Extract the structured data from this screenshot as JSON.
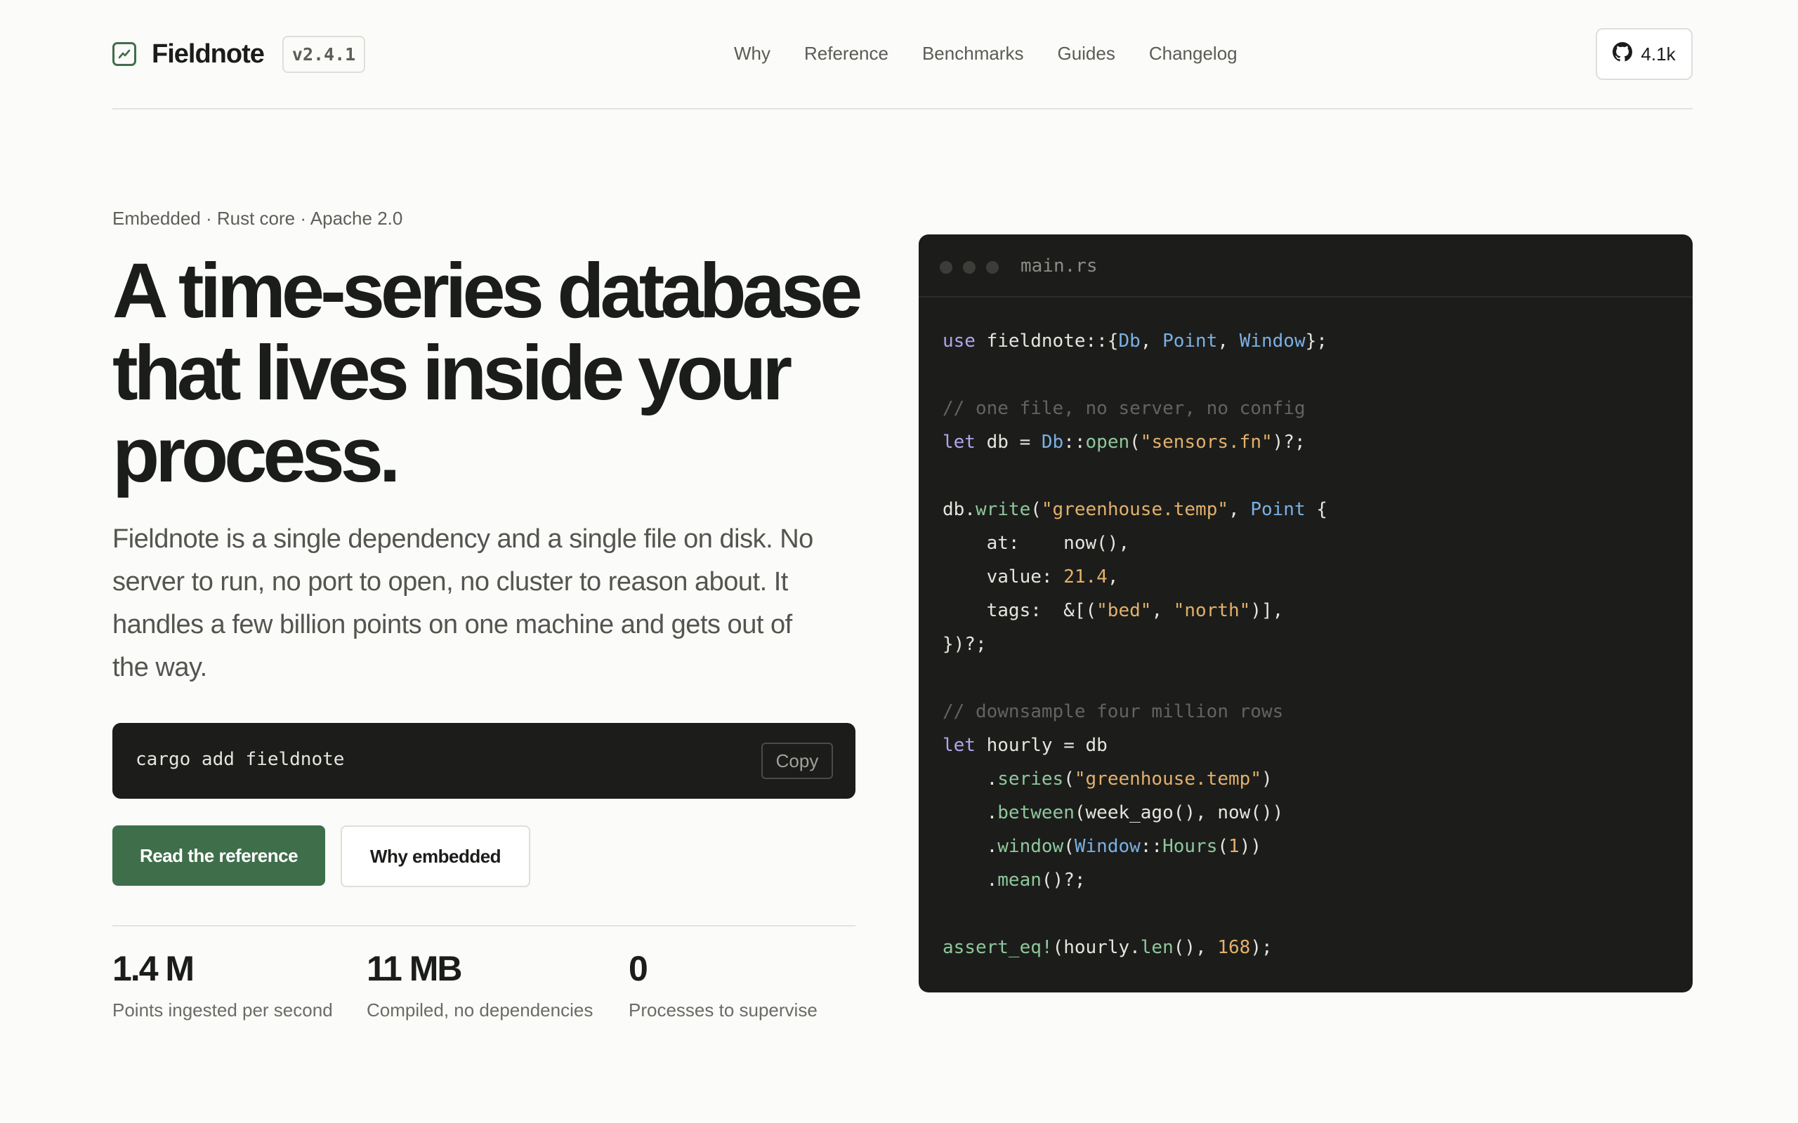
{
  "brand": {
    "name": "Fieldnote",
    "version": "v2.4.1",
    "icon": "chart-icon"
  },
  "nav": [
    "Why",
    "Reference",
    "Benchmarks",
    "Guides",
    "Changelog"
  ],
  "github": {
    "stars": "4.1k",
    "icon": "github-icon"
  },
  "hero": {
    "kicker": "Embedded · Rust core · Apache 2.0",
    "title": "A time-series database that lives inside your process.",
    "lede": "Fieldnote is a single dependency and a single file on disk. No server to run, no port to open, no cluster to reason about. It handles a few billion points on one machine and gets out of the way."
  },
  "install": {
    "command": "cargo add fieldnote",
    "copy_label": "Copy"
  },
  "buttons": {
    "primary": "Read the reference",
    "secondary": "Why embedded"
  },
  "stats": [
    {
      "value": "1.4 M",
      "label": "Points ingested per second"
    },
    {
      "value": "11 MB",
      "label": "Compiled, no dependencies"
    },
    {
      "value": "0",
      "label": "Processes to supervise"
    }
  ],
  "code": {
    "filename": "main.rs",
    "lines": [
      [
        [
          "kw",
          "use"
        ],
        [
          "pl",
          " fieldnote::{"
        ],
        [
          "ty",
          "Db"
        ],
        [
          "pl",
          ", "
        ],
        [
          "ty",
          "Point"
        ],
        [
          "pl",
          ", "
        ],
        [
          "ty",
          "Window"
        ],
        [
          "pl",
          "};"
        ]
      ],
      [],
      [
        [
          "cm",
          "// one file, no server, no config"
        ]
      ],
      [
        [
          "kw",
          "let"
        ],
        [
          "pl",
          " db = "
        ],
        [
          "ty",
          "Db"
        ],
        [
          "pl",
          "::"
        ],
        [
          "fn",
          "open"
        ],
        [
          "pl",
          "("
        ],
        [
          "st",
          "\"sensors.fn\""
        ],
        [
          "pl",
          ")?;"
        ]
      ],
      [],
      [
        [
          "pl",
          "db."
        ],
        [
          "fn",
          "write"
        ],
        [
          "pl",
          "("
        ],
        [
          "st",
          "\"greenhouse.temp\""
        ],
        [
          "pl",
          ", "
        ],
        [
          "ty",
          "Point"
        ],
        [
          "pl",
          " {"
        ]
      ],
      [
        [
          "pl",
          "    at:    now(),"
        ]
      ],
      [
        [
          "pl",
          "    value: "
        ],
        [
          "nm",
          "21.4"
        ],
        [
          "pl",
          ","
        ]
      ],
      [
        [
          "pl",
          "    tags:  &[("
        ],
        [
          "st",
          "\"bed\""
        ],
        [
          "pl",
          ", "
        ],
        [
          "st",
          "\"north\""
        ],
        [
          "pl",
          ")],"
        ]
      ],
      [
        [
          "pl",
          "})?;"
        ]
      ],
      [],
      [
        [
          "cm",
          "// downsample four million rows"
        ]
      ],
      [
        [
          "kw",
          "let"
        ],
        [
          "pl",
          " hourly = db"
        ]
      ],
      [
        [
          "pl",
          "    ."
        ],
        [
          "fn",
          "series"
        ],
        [
          "pl",
          "("
        ],
        [
          "st",
          "\"greenhouse.temp\""
        ],
        [
          "pl",
          ")"
        ]
      ],
      [
        [
          "pl",
          "    ."
        ],
        [
          "fn",
          "between"
        ],
        [
          "pl",
          "(week_ago(), now())"
        ]
      ],
      [
        [
          "pl",
          "    ."
        ],
        [
          "fn",
          "window"
        ],
        [
          "pl",
          "("
        ],
        [
          "ty",
          "Window"
        ],
        [
          "pl",
          "::"
        ],
        [
          "fn",
          "Hours"
        ],
        [
          "pl",
          "("
        ],
        [
          "nm",
          "1"
        ],
        [
          "pl",
          "))"
        ]
      ],
      [
        [
          "pl",
          "    ."
        ],
        [
          "fn",
          "mean"
        ],
        [
          "pl",
          "()?;"
        ]
      ],
      [],
      [
        [
          "fn",
          "assert_eq!"
        ],
        [
          "pl",
          "(hourly."
        ],
        [
          "fn",
          "len"
        ],
        [
          "pl",
          "(), "
        ],
        [
          "nm",
          "168"
        ],
        [
          "pl",
          ");"
        ]
      ]
    ]
  }
}
